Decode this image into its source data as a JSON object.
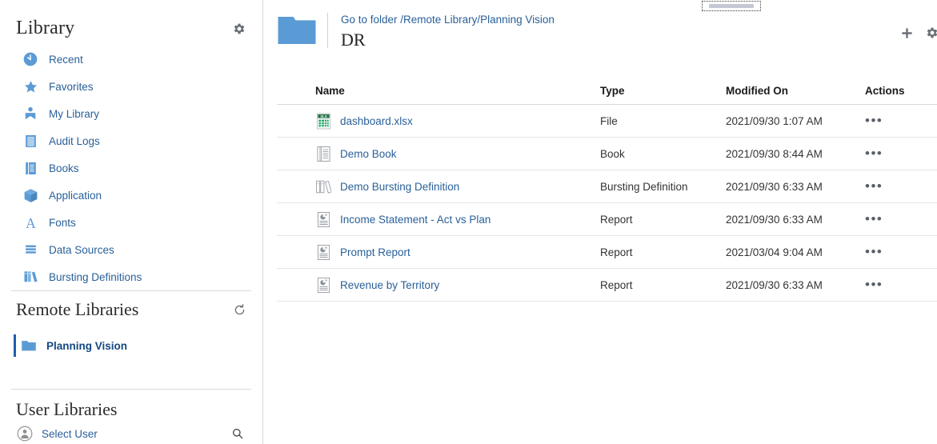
{
  "colors": {
    "link": "#2a6099",
    "link_strong": "#13477f",
    "icon_blue": "#5b9bd5",
    "accent_bar": "#1f5fa9",
    "gray_icon": "#6b7077",
    "excel_green": "#1e7145",
    "border": "#e6e6e6"
  },
  "sidebar": {
    "title": "Library",
    "settings_icon": "gear-icon",
    "items": [
      {
        "label": "Recent",
        "icon": "clock-icon"
      },
      {
        "label": "Favorites",
        "icon": "star-icon"
      },
      {
        "label": "My Library",
        "icon": "my-library-icon"
      },
      {
        "label": "Audit Logs",
        "icon": "audit-logs-icon"
      },
      {
        "label": "Books",
        "icon": "book-icon"
      },
      {
        "label": "Application",
        "icon": "cube-icon"
      },
      {
        "label": "Fonts",
        "icon": "font-a-icon"
      },
      {
        "label": "Data Sources",
        "icon": "data-sources-icon"
      },
      {
        "label": "Bursting Definitions",
        "icon": "bursting-definitions-icon"
      }
    ],
    "remote": {
      "title": "Remote Libraries",
      "refresh_icon": "refresh-icon",
      "items": [
        {
          "label": "Planning Vision",
          "icon": "folder-icon",
          "selected": true
        }
      ]
    },
    "user": {
      "title": "User Libraries",
      "select_user_label": "Select User",
      "avatar_icon": "user-avatar-icon",
      "search_icon": "search-icon"
    }
  },
  "main": {
    "drag_handle": "resize-handle",
    "folder_icon": "folder-icon",
    "breadcrumb_link": "Go to folder /Remote Library/Planning Vision",
    "folder_name": "DR",
    "actions": {
      "add_label": "plus-icon",
      "settings_label": "gear-icon"
    },
    "table": {
      "columns": [
        "Name",
        "Type",
        "Modified On",
        "Actions"
      ],
      "action_glyph": "•••",
      "rows": [
        {
          "name": "dashboard.xlsx",
          "icon": "excel-file-icon",
          "type": "File",
          "modified": "2021/09/30 1:07 AM"
        },
        {
          "name": "Demo Book",
          "icon": "book-doc-icon",
          "type": "Book",
          "modified": "2021/09/30 8:44 AM"
        },
        {
          "name": "Demo Bursting Definition",
          "icon": "bursting-definition-icon",
          "type": "Bursting Definition",
          "modified": "2021/09/30 6:33 AM"
        },
        {
          "name": "Income Statement - Act vs Plan",
          "icon": "report-icon",
          "type": "Report",
          "modified": "2021/09/30 6:33 AM"
        },
        {
          "name": "Prompt Report",
          "icon": "report-icon",
          "type": "Report",
          "modified": "2021/03/04 9:04 AM"
        },
        {
          "name": "Revenue by Territory",
          "icon": "report-icon",
          "type": "Report",
          "modified": "2021/09/30 6:33 AM"
        }
      ]
    }
  }
}
